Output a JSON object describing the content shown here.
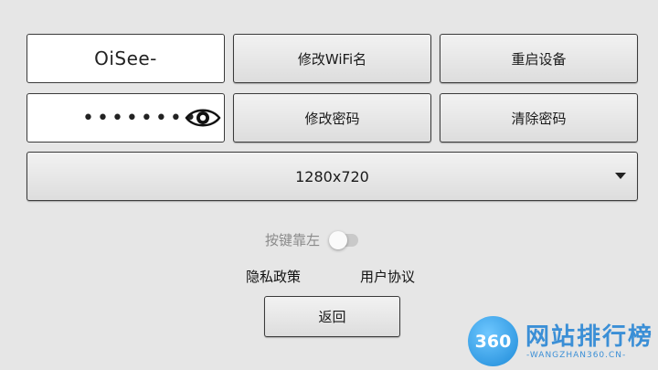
{
  "wifi": {
    "ssid_value": "OiSee-",
    "password_masked": "••••••••"
  },
  "buttons": {
    "rename_wifi": "修改WiFi名",
    "reboot_device": "重启设备",
    "change_password": "修改密码",
    "clear_password": "清除密码",
    "back": "返回"
  },
  "resolution": {
    "selected": "1280x720"
  },
  "toggle": {
    "label": "按键靠左",
    "on": false
  },
  "links": {
    "privacy_policy": "隐私政策",
    "user_agreement": "用户协议"
  },
  "watermark": {
    "logo_text": "360",
    "title": "网站排行榜",
    "subtitle": "-WANGZHAN360.CN-"
  },
  "icons": {
    "password_visibility": "eye-icon",
    "dropdown": "caret-down-icon"
  },
  "colors": {
    "background": "#e6e6e6",
    "watermark_blue": "#3b8fd6"
  }
}
